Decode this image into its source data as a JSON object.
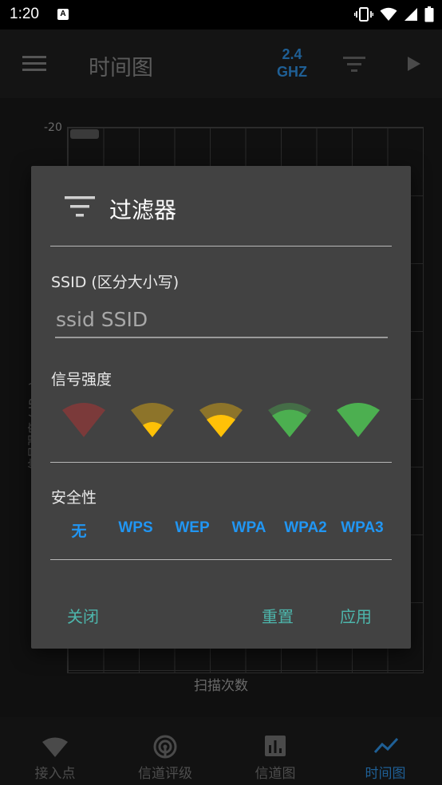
{
  "status_bar": {
    "time": "1:20",
    "notification_icon_letter": "A"
  },
  "toolbar": {
    "title": "时间图",
    "band_line1": "2.4",
    "band_line2": "GHZ"
  },
  "chart": {
    "y_tick_top": "-20",
    "y_label": "信号强度 (dBm)",
    "x_label": "扫描次数"
  },
  "dialog": {
    "title": "过滤器",
    "ssid_label": "SSID (区分大小写)",
    "ssid_placeholder": "ssid SSID",
    "signal_label": "信号强度",
    "signal_levels": [
      {
        "name": "level-1",
        "color": "#d32f2f",
        "bars": 0
      },
      {
        "name": "level-2",
        "color": "#ffc107",
        "bars": 1
      },
      {
        "name": "level-3",
        "color": "#ffc107",
        "bars": 2
      },
      {
        "name": "level-4",
        "color": "#4caf50",
        "bars": 3
      },
      {
        "name": "level-5",
        "color": "#4caf50",
        "bars": 4
      }
    ],
    "security_label": "安全性",
    "security_options": [
      "无",
      "WPS",
      "WEP",
      "WPA",
      "WPA2",
      "WPA3"
    ],
    "close_label": "关闭",
    "reset_label": "重置",
    "apply_label": "应用"
  },
  "bottom_nav": {
    "items": [
      {
        "label": "接入点",
        "icon": "wifi-icon",
        "active": false
      },
      {
        "label": "信道评级",
        "icon": "signal-rating-icon",
        "active": false
      },
      {
        "label": "信道图",
        "icon": "bar-chart-icon",
        "active": false
      },
      {
        "label": "时间图",
        "icon": "line-chart-icon",
        "active": true
      }
    ]
  },
  "colors": {
    "accent": "#2196f3",
    "action_text": "#4db6ac",
    "dialog_bg": "#424242"
  }
}
